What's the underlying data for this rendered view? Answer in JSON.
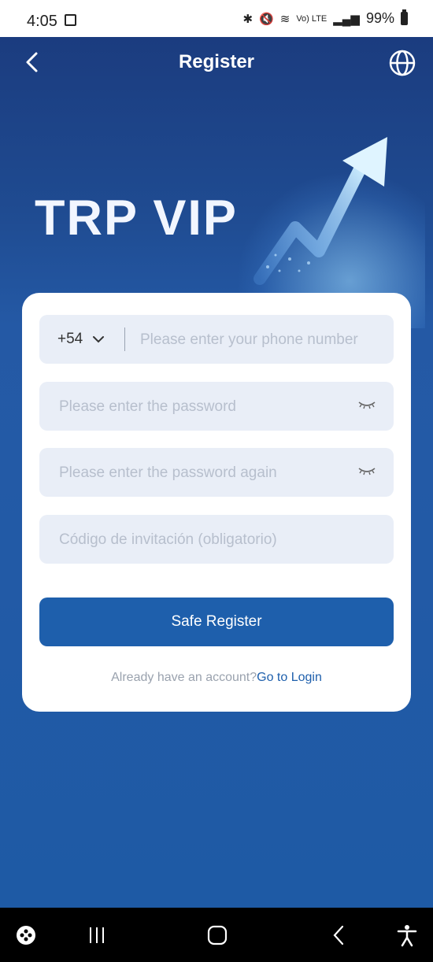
{
  "status_bar": {
    "time": "4:05",
    "network": "Vo) LTE",
    "battery": "99%"
  },
  "header": {
    "title": "Register",
    "back_icon": "chevron-left-icon",
    "language_icon": "globe-icon"
  },
  "hero": {
    "brand": "TRP VIP"
  },
  "form": {
    "country_code": "+54",
    "phone_placeholder": "Please enter your phone number",
    "password_placeholder": "Please enter the password",
    "password_again_placeholder": "Please enter the password again",
    "invite_placeholder": "Código de invitación (obligatorio)",
    "submit_label": "Safe Register",
    "login_prompt": "Already have an account?",
    "login_link": "Go to Login"
  },
  "colors": {
    "primary": "#1e5fac",
    "field_bg": "#e9eef7",
    "hero_top": "#1b3c7f"
  }
}
